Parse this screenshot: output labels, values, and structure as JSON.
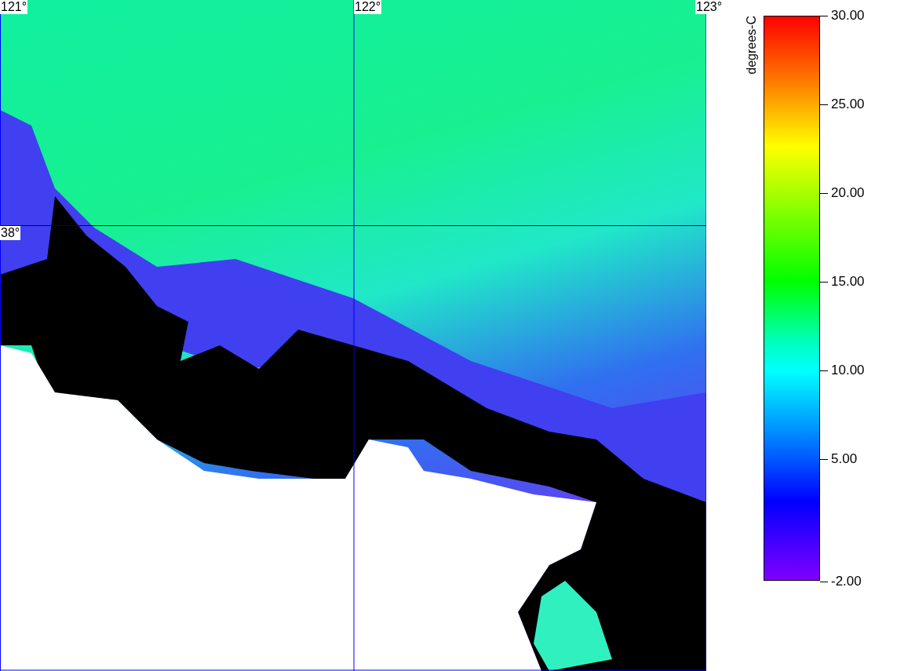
{
  "map": {
    "longitude_labels": [
      "121°",
      "122°",
      "123°"
    ],
    "latitude_labels": [
      "38°"
    ]
  },
  "colorbar": {
    "unit": "degrees-C",
    "ticks": [
      "30.00",
      "25.00",
      "20.00",
      "15.00",
      "10.00",
      "5.00",
      "-2.00"
    ]
  }
}
